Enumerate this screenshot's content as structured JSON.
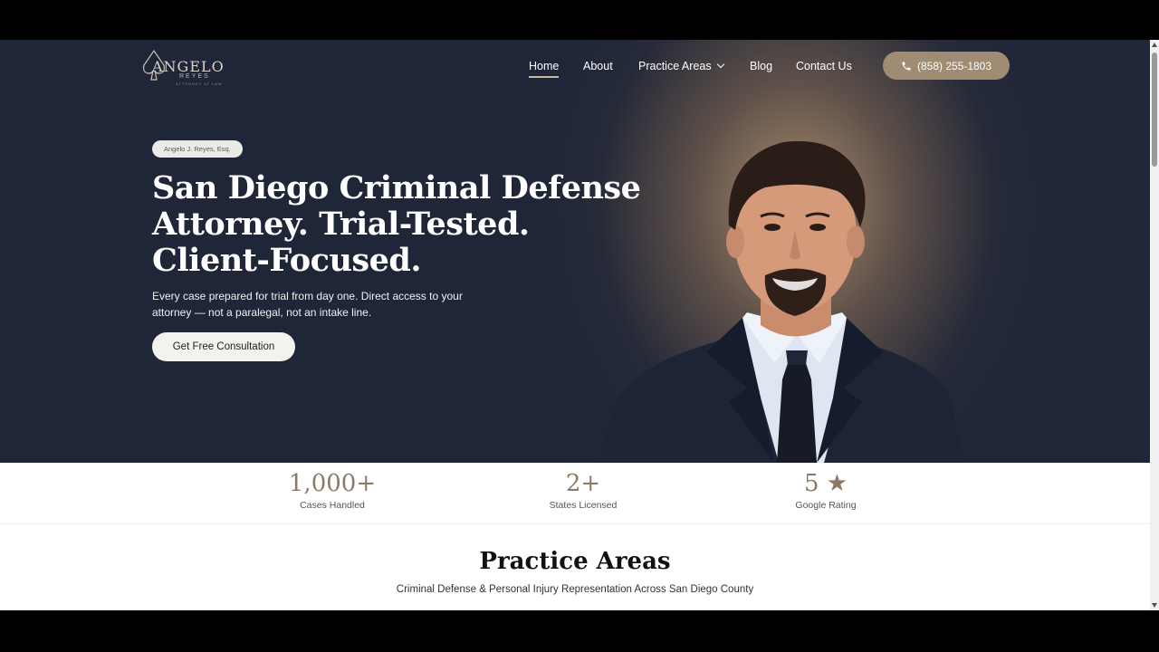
{
  "brand": {
    "logo_name": "ANGELO",
    "logo_sub": "REYES",
    "logo_tag": "ATTORNEY AT LAW"
  },
  "nav": {
    "items": [
      {
        "label": "Home",
        "active": true
      },
      {
        "label": "About",
        "active": false
      },
      {
        "label": "Practice Areas",
        "active": false,
        "has_dropdown": true
      },
      {
        "label": "Blog",
        "active": false
      },
      {
        "label": "Contact Us",
        "active": false
      }
    ],
    "phone_label": "(858) 255-1803",
    "phone_icon": "phone-icon"
  },
  "hero": {
    "badge": "Angelo J. Reyes, Esq.",
    "headline_lines": [
      "San Diego Criminal Defense",
      "Attorney. Trial-Tested.",
      "Client-Focused."
    ],
    "subcopy": "Every case prepared for trial from day one. Direct access to your attorney — not a paralegal, not an intake line.",
    "cta_label": "Get Free Consultation"
  },
  "stats": [
    {
      "value": "1,000+",
      "label": "Cases Handled"
    },
    {
      "value": "2+",
      "label": "States Licensed"
    },
    {
      "value": "5 ★",
      "label": "Google Rating"
    }
  ],
  "practice": {
    "title": "Practice Areas",
    "subtitle": "Criminal Defense & Personal Injury Representation Across San Diego County"
  },
  "colors": {
    "hero_bg": "#1f2637",
    "accent": "#a08b73",
    "stat_value": "#8d7a66"
  }
}
